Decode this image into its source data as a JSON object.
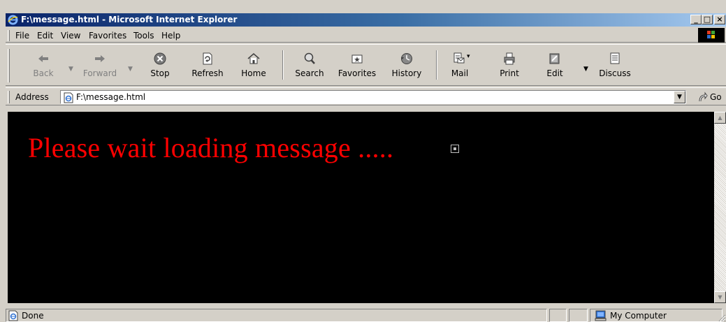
{
  "window": {
    "title": "F:\\message.html - Microsoft Internet Explorer",
    "controls": {
      "minimize": "_",
      "maximize": "□",
      "close": "×"
    }
  },
  "menu": [
    {
      "label": "File"
    },
    {
      "label": "Edit"
    },
    {
      "label": "View"
    },
    {
      "label": "Favorites"
    },
    {
      "label": "Tools"
    },
    {
      "label": "Help"
    }
  ],
  "toolbar": {
    "back": {
      "label": "Back",
      "icon": "back-arrow-icon",
      "enabled": false
    },
    "forward": {
      "label": "Forward",
      "icon": "forward-arrow-icon",
      "enabled": false
    },
    "stop": {
      "label": "Stop",
      "icon": "stop-icon"
    },
    "refresh": {
      "label": "Refresh",
      "icon": "refresh-icon"
    },
    "home": {
      "label": "Home",
      "icon": "home-icon"
    },
    "search": {
      "label": "Search",
      "icon": "search-icon"
    },
    "favorites": {
      "label": "Favorites",
      "icon": "favorites-icon"
    },
    "history": {
      "label": "History",
      "icon": "history-icon"
    },
    "mail": {
      "label": "Mail",
      "icon": "mail-icon"
    },
    "print": {
      "label": "Print",
      "icon": "print-icon"
    },
    "edit": {
      "label": "Edit",
      "icon": "edit-icon"
    },
    "discuss": {
      "label": "Discuss",
      "icon": "discuss-icon"
    }
  },
  "address": {
    "label": "Address",
    "value": "F:\\message.html",
    "go_label": "Go"
  },
  "page": {
    "message": "Please wait loading message .....",
    "background": "#000000",
    "text_color": "#ff0000"
  },
  "status": {
    "text": "Done",
    "zone": "My Computer"
  },
  "colors": {
    "title_gradient_start": "#0a246a",
    "title_gradient_end": "#a6caf0",
    "chrome": "#d4d0c8"
  }
}
